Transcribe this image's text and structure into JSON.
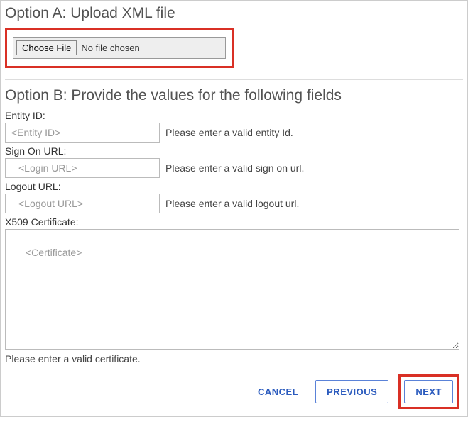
{
  "optionA": {
    "title": "Option A: Upload XML file",
    "chooseFileLabel": "Choose File",
    "fileStatus": "No file chosen"
  },
  "optionB": {
    "title": "Option B: Provide the values for the following fields",
    "entityId": {
      "label": "Entity ID:",
      "placeholder": "<Entity ID>",
      "hint": "Please enter a valid entity Id."
    },
    "signOn": {
      "label": "Sign On URL:",
      "placeholder": "<Login URL>",
      "hint": "Please enter a valid sign on url."
    },
    "logout": {
      "label": "Logout URL:",
      "placeholder": "<Logout URL>",
      "hint": "Please enter a valid logout url."
    },
    "cert": {
      "label": "X509 Certificate:",
      "placeholder": "<Certificate>",
      "hint": "Please enter a valid certificate."
    }
  },
  "buttons": {
    "cancel": "CANCEL",
    "previous": "PREVIOUS",
    "next": "NEXT"
  }
}
